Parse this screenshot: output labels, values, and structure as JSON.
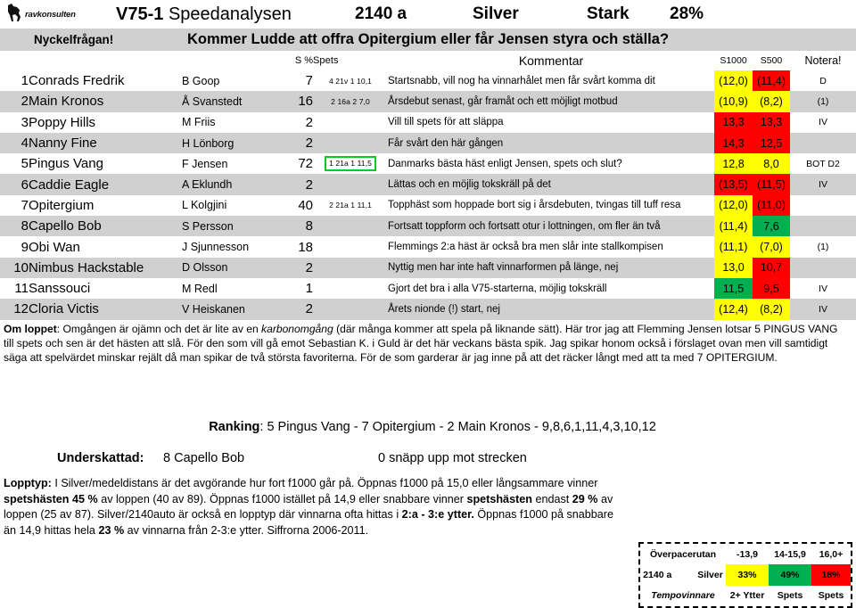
{
  "header": {
    "logo_text": "ravkonsulten",
    "race_id": "V75-1",
    "product": "Speedanalysen",
    "distance": "2140 a",
    "class": "Silver",
    "tempo": "Stark",
    "percent": "28%"
  },
  "keyquestion": {
    "label": "Nyckelfrågan!",
    "text": "Kommer Ludde att offra Opitergium eller får Jensen styra och ställa?"
  },
  "table": {
    "columns": {
      "spets_pct": "S %",
      "spets": "Spets",
      "comment": "Kommentar",
      "s1000": "S1000",
      "s500": "S500",
      "note": "Notera!"
    },
    "rows": [
      {
        "num": "1",
        "horse": "Conrads Fredrik",
        "driver": "B Goop",
        "spets_pct": "7",
        "spets": "4 21v 1 10,1",
        "spets_boxed": false,
        "comment": "Startsnabb, vill nog ha vinnarhålet men får svårt komma dit",
        "s1000": "(12,0)",
        "s1000_color": "yellow",
        "s500": "(11,4)",
        "s500_color": "red",
        "note": "D"
      },
      {
        "num": "2",
        "horse": "Main Kronos",
        "driver": "Å Svanstedt",
        "spets_pct": "16",
        "spets": "2 16a 2  7,0",
        "spets_boxed": false,
        "comment": "Årsdebut senast, går framåt och ett möjligt motbud",
        "s1000": "(10,9)",
        "s1000_color": "yellow",
        "s500": "(8,2)",
        "s500_color": "yellow",
        "note": "(1)"
      },
      {
        "num": "3",
        "horse": "Poppy Hills",
        "driver": "M Friis",
        "spets_pct": "2",
        "spets": "",
        "spets_boxed": false,
        "comment": "Vill till spets för att släppa",
        "s1000": "13,3",
        "s1000_color": "red",
        "s500": "13,3",
        "s500_color": "red",
        "note": "IV"
      },
      {
        "num": "4",
        "horse": "Nanny Fine",
        "driver": "H Lönborg",
        "spets_pct": "2",
        "spets": "",
        "spets_boxed": false,
        "comment": "Får svårt den här gången",
        "s1000": "14,3",
        "s1000_color": "red",
        "s500": "12,5",
        "s500_color": "red",
        "note": ""
      },
      {
        "num": "5",
        "horse": "Pingus Vang",
        "driver": "F Jensen",
        "spets_pct": "72",
        "spets": "1 21a 1 11,5",
        "spets_boxed": true,
        "comment": "Danmarks bästa häst enligt Jensen, spets och slut?",
        "s1000": "12,8",
        "s1000_color": "yellow",
        "s500": "8,0",
        "s500_color": "yellow",
        "note": "BOT D2"
      },
      {
        "num": "6",
        "horse": "Caddie Eagle",
        "driver": "A Eklundh",
        "spets_pct": "2",
        "spets": "",
        "spets_boxed": false,
        "comment": "Lättas och en möjlig tokskräll på det",
        "s1000": "(13,5)",
        "s1000_color": "red",
        "s500": "(11,5)",
        "s500_color": "red",
        "note": "IV"
      },
      {
        "num": "7",
        "horse": "Opitergium",
        "driver": "L Kolgjini",
        "spets_pct": "40",
        "spets": "2 21a 1 11,1",
        "spets_boxed": false,
        "comment": "Topphäst som hoppade bort sig i årsdebuten, tvingas till tuff resa",
        "s1000": "(12,0)",
        "s1000_color": "yellow",
        "s500": "(11,0)",
        "s500_color": "red",
        "note": ""
      },
      {
        "num": "8",
        "horse": "Capello Bob",
        "driver": "S Persson",
        "spets_pct": "8",
        "spets": "",
        "spets_boxed": false,
        "comment": "Fortsatt toppform och fortsatt otur i lottningen, om fler än två",
        "s1000": "(11,4)",
        "s1000_color": "yellow",
        "s500": "7,6",
        "s500_color": "green",
        "note": ""
      },
      {
        "num": "9",
        "horse": "Obi Wan",
        "driver": "J Sjunnesson",
        "spets_pct": "18",
        "spets": "",
        "spets_boxed": false,
        "comment": "Flemmings 2:a häst är också bra men slår inte stallkompisen",
        "s1000": "(11,1)",
        "s1000_color": "yellow",
        "s500": "(7,0)",
        "s500_color": "yellow",
        "note": "(1)"
      },
      {
        "num": "10",
        "horse": "Nimbus Hackstable",
        "driver": "D Olsson",
        "spets_pct": "2",
        "spets": "",
        "spets_boxed": false,
        "comment": "Nyttig men har inte haft vinnarformen på länge, nej",
        "s1000": "13,0",
        "s1000_color": "yellow",
        "s500": "10,7",
        "s500_color": "red",
        "note": ""
      },
      {
        "num": "11",
        "horse": "Sanssouci",
        "driver": "M Redl",
        "spets_pct": "1",
        "spets": "",
        "spets_boxed": false,
        "comment": "Gjort det bra i alla V75-starterna, möjlig tokskräll",
        "s1000": "11,5",
        "s1000_color": "green",
        "s500": "9,5",
        "s500_color": "red",
        "note": "IV"
      },
      {
        "num": "12",
        "horse": "Cloria Victis",
        "driver": "V Heiskanen",
        "spets_pct": "2",
        "spets": "",
        "spets_boxed": false,
        "comment": "Årets nionde (!) start, nej",
        "s1000": "(12,4)",
        "s1000_color": "yellow",
        "s500": "(8,2)",
        "s500_color": "yellow",
        "note": "IV"
      }
    ]
  },
  "omloppet": {
    "label": "Om loppet",
    "part1": ": Omgången är ojämn och det är lite av en ",
    "italic": "karbonomgång",
    "part2": " (där många kommer att spela på liknande sätt). Här tror jag att Flemming Jensen lotsar 5 PINGUS VANG till spets och sen är det hästen att slå. För den som vill gå emot Sebastian K. i Guld är det här veckans bästa spik. Jag spikar honom också i förslaget ovan men vill samtidigt säga att spelvärdet minskar rejält då man spikar de två största favoriterna. För de som garderar är jag inne på att det räcker långt med att ta med 7 OPITERGIUM."
  },
  "ranking": {
    "label": "Ranking",
    "value": ": 5 Pingus Vang - 7 Opitergium - 2 Main Kronos - 9,8,6,1,11,4,3,10,12"
  },
  "underskattad": {
    "label": "Underskattad:",
    "horse": "8 Capello Bob",
    "snapp": "0 snäpp upp mot strecken"
  },
  "lopptyp": {
    "label": "Lopptyp:",
    "t1": " I Silver/medeldistans är det avgörande hur fort f1000 går på. Öppnas f1000 på 15,0 eller långsammare vinner ",
    "b1": "spetshästen 45 %",
    "t2": " av loppen (40 av 89). Öppnas f1000 istället på 14,9 eller snabbare vinner ",
    "b2": "spetshästen",
    "t3": " endast ",
    "b3": "29 %",
    "t4": " av loppen (25 av 87). Silver/2140auto är också en lopptyp där vinnarna ofta hittas i ",
    "b4": "2:a - 3:e ytter.",
    "t5": " Öppnas f1000 på snabbare än 14,9 hittas hela ",
    "b5": "23 %",
    "t6": " av vinnarna från 2-3:e ytter. Siffrorna 2006-2011."
  },
  "legend": {
    "title": "Överpacerutan",
    "range1": "-13,9",
    "range2": "14-15,9",
    "range3": "16,0+",
    "distance": "2140 a",
    "class": "Silver",
    "pct1": "33%",
    "pct2": "49%",
    "pct3": "18%",
    "footer_label": "Tempovinnare",
    "foot1": "2+ Ytter",
    "foot2": "Spets",
    "foot3": "Spets",
    "pct1_color": "yellow",
    "pct2_color": "green",
    "pct3_color": "red"
  }
}
